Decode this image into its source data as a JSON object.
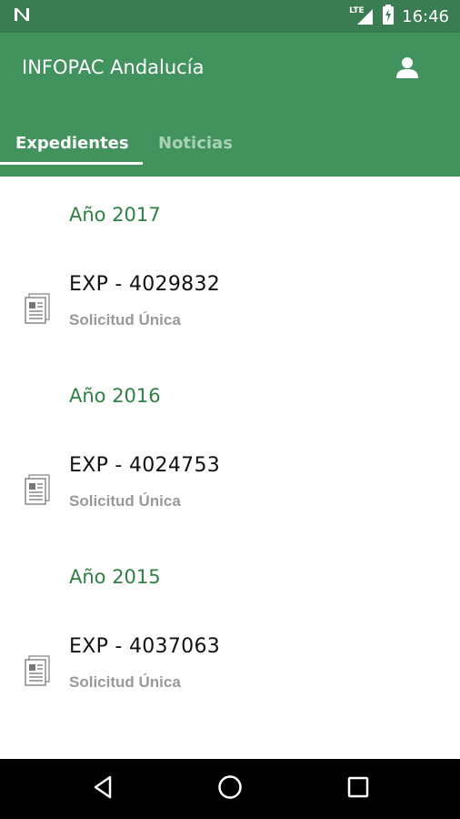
{
  "status_bar": {
    "time": "16:46",
    "network_label": "LTE",
    "icons": [
      "notification-n-icon",
      "lte-signal-icon",
      "battery-charging-icon"
    ]
  },
  "app_bar": {
    "title": "INFOPAC Andalucía",
    "account_icon": "person-icon",
    "background_color": "#42925d"
  },
  "tabs": [
    {
      "label": "Expedientes",
      "active": true
    },
    {
      "label": "Noticias",
      "active": false
    }
  ],
  "groups": [
    {
      "year_label": "Año 2017",
      "items": [
        {
          "title": "EXP - 4029832",
          "subtitle": "Solicitud Única",
          "icon": "document-icon"
        }
      ]
    },
    {
      "year_label": "Año 2016",
      "items": [
        {
          "title": "EXP - 4024753",
          "subtitle": "Solicitud Única",
          "icon": "document-icon"
        }
      ]
    },
    {
      "year_label": "Año 2015",
      "items": [
        {
          "title": "EXP - 4037063",
          "subtitle": "Solicitud Única",
          "icon": "document-icon"
        }
      ]
    }
  ],
  "nav_bar": {
    "buttons": [
      "back-icon",
      "home-icon",
      "recents-icon"
    ]
  },
  "colors": {
    "primary": "#42925d",
    "status_bar": "#3a7d52",
    "year_header": "#2f8043",
    "subtitle": "#999999"
  }
}
